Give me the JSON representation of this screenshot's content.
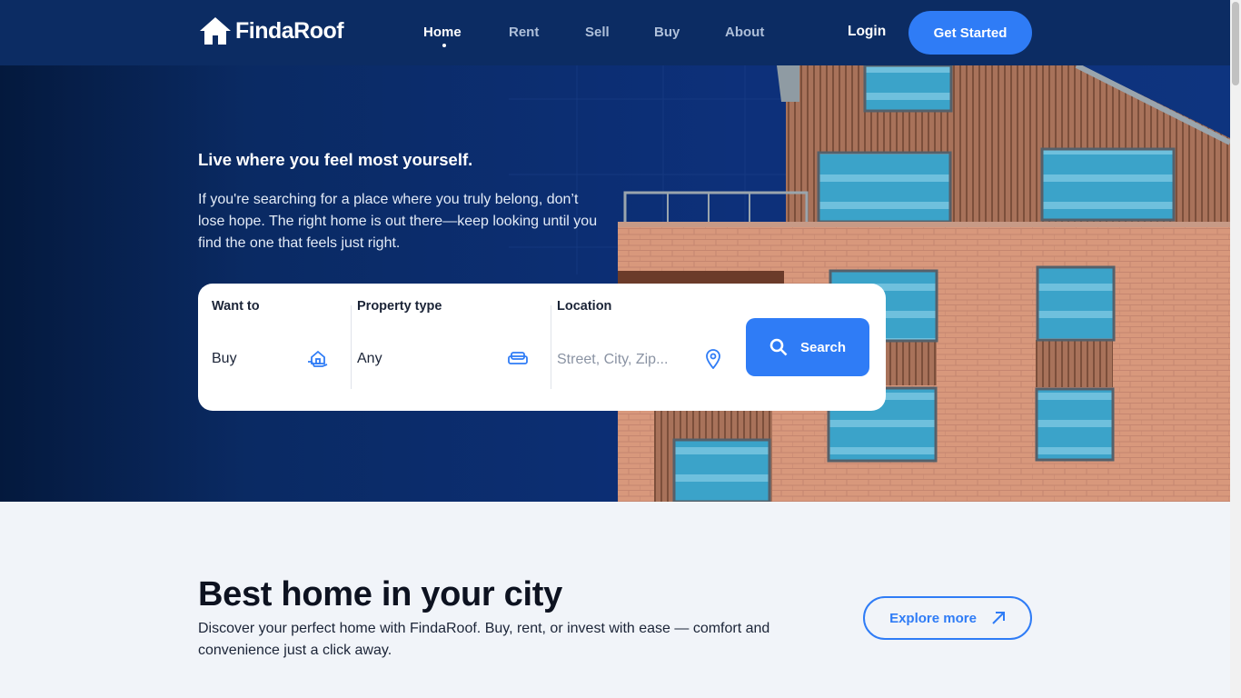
{
  "header": {
    "logo_text": "FindaRoof",
    "nav": [
      "Home",
      "Rent",
      "Sell",
      "Buy",
      "About"
    ],
    "active_nav": "Home",
    "login": "Login",
    "cta": "Get Started"
  },
  "hero": {
    "tagline": "Live where you feel most yourself.",
    "description": "If you're searching for a place where you truly belong, don’t lose hope. The right home is out there—keep looking until you find the one that feels just right.",
    "search": {
      "want_to": {
        "label": "Want to",
        "value": "Buy",
        "icon": "hand-house-icon"
      },
      "property_type": {
        "label": "Property type",
        "value": "Any",
        "icon": "sofa-icon"
      },
      "location": {
        "label": "Location",
        "placeholder": "Street, City, Zip...",
        "icon": "map-pin-icon"
      },
      "button": "Search"
    }
  },
  "section": {
    "title": "Best home in your city",
    "description": "Discover your perfect home with FindaRoof. Buy, rent, or invest with ease — comfort and convenience just a click away.",
    "explore": "Explore more"
  },
  "colors": {
    "header_bg": "#0c2c63",
    "accent": "#2f7cf6",
    "page_bg": "#f1f4f9"
  }
}
